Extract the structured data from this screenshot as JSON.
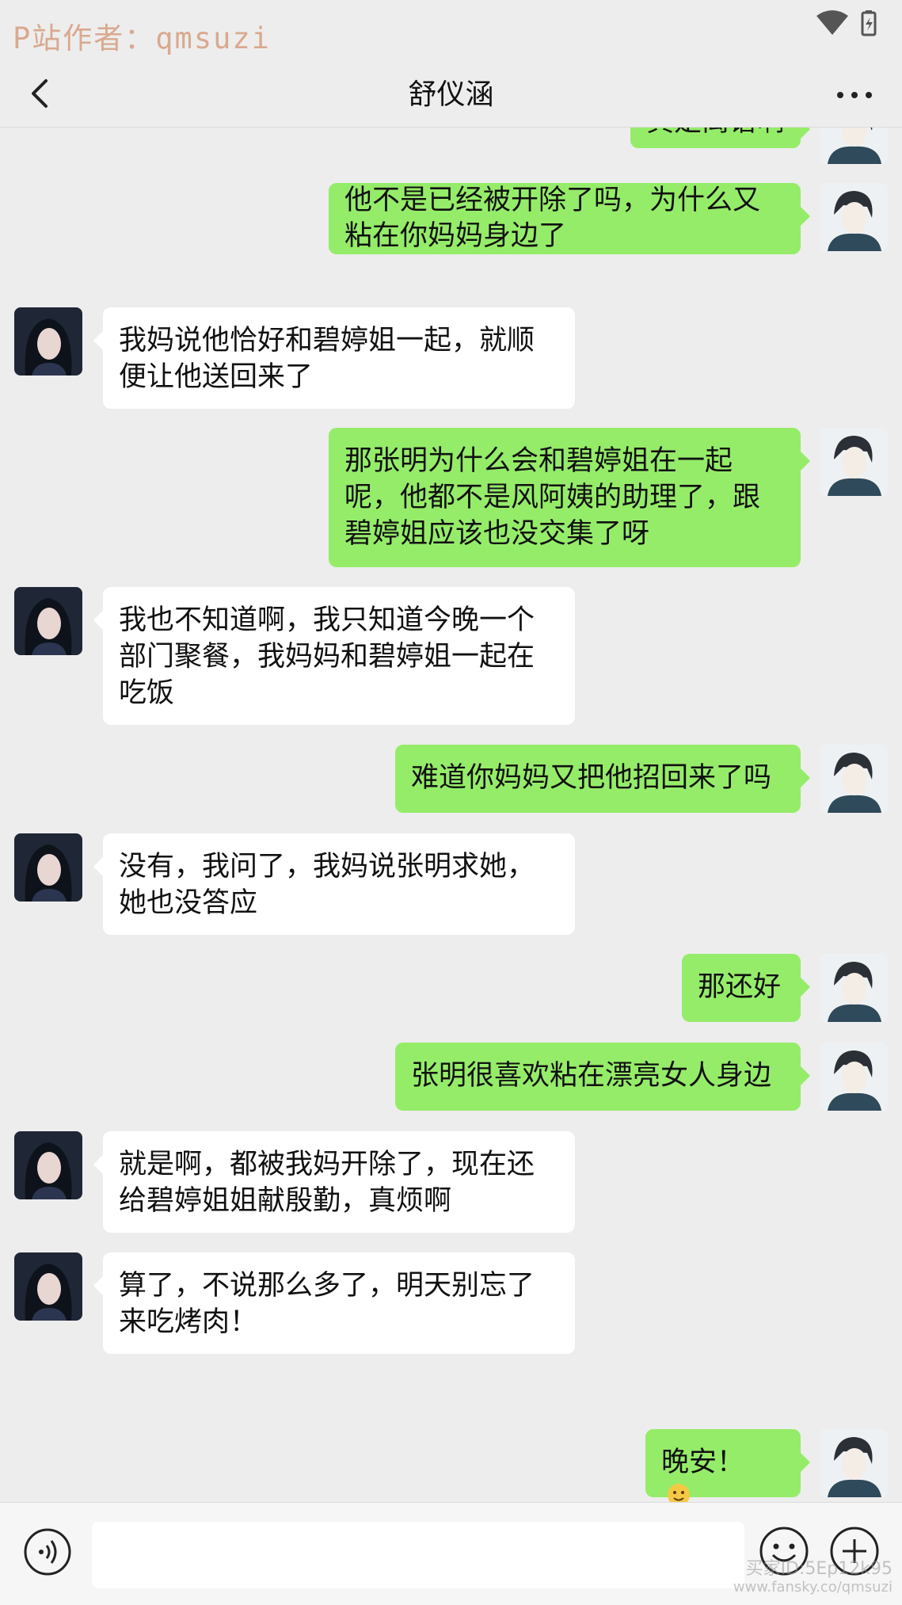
{
  "status_bar": {
    "watermark": "P站作者：qmsuzi"
  },
  "header": {
    "title": "舒仪涵",
    "back_icon": "chevron-left-icon",
    "more_icon": "more-dots-icon"
  },
  "messages": [
    {
      "side": "out",
      "text": "真是离谱啊"
    },
    {
      "side": "out",
      "text": "他不是已经被开除了吗，为什么又\n粘在你妈妈身边了"
    },
    {
      "side": "in",
      "text": "我妈说他恰好和碧婷姐一起，就顺\n便让他送回来了"
    },
    {
      "side": "out",
      "text": "那张明为什么会和碧婷姐在一起\n呢，他都不是风阿姨的助理了，跟\n碧婷姐应该也没交集了呀"
    },
    {
      "side": "in",
      "text": "我也不知道啊，我只知道今晚一个\n部门聚餐，我妈妈和碧婷姐一起在\n吃饭"
    },
    {
      "side": "out",
      "text": "难道你妈妈又把他招回来了吗"
    },
    {
      "side": "in",
      "text": "没有，我问了，我妈说张明求她，\n她也没答应"
    },
    {
      "side": "out",
      "text": "那还好"
    },
    {
      "side": "out",
      "text": "张明很喜欢粘在漂亮女人身边"
    },
    {
      "side": "in",
      "text": "就是啊，都被我妈开除了，现在还\n给碧婷姐姐献殷勤，真烦啊"
    },
    {
      "side": "in",
      "text": "算了，不说那么多了，明天别忘了\n来吃烤肉！"
    },
    {
      "side": "out",
      "text": "晚安！",
      "emoji": "hugging-face-emoji"
    }
  ],
  "input_bar": {
    "voice_icon": "voice-icon",
    "emoji_icon": "smiley-icon",
    "plus_icon": "plus-circle-icon",
    "input_value": ""
  },
  "bottom_watermark": {
    "line1": "买家ID:5Ep12k95",
    "line2": "www.fansky.co/qmsuzi"
  },
  "colors": {
    "background": "#ededed",
    "outgoing_bubble": "#95ec69",
    "incoming_bubble": "#ffffff"
  }
}
